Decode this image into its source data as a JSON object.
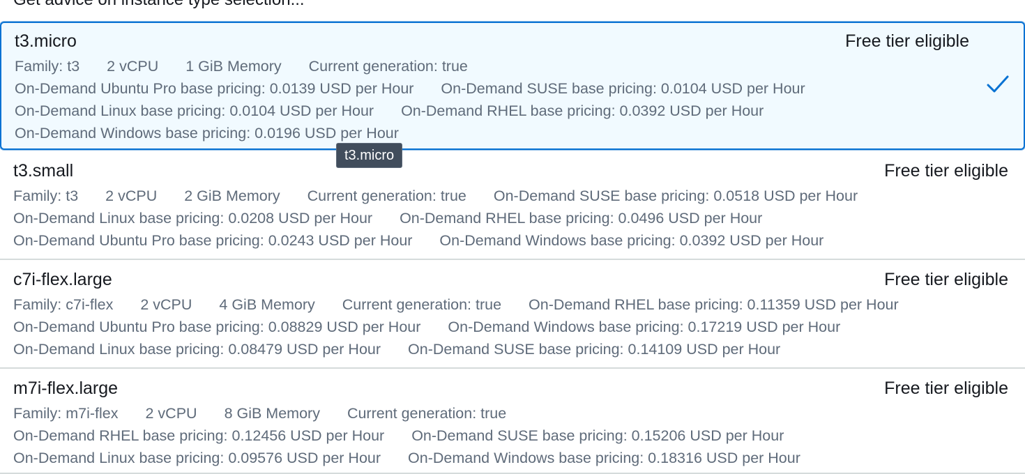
{
  "advice_link": "Get advice on instance type selection...",
  "tooltip": "t3.micro",
  "options": [
    {
      "name": "t3.micro",
      "badge": "Free tier eligible",
      "selected": true,
      "lines": [
        [
          "Family: t3",
          "2 vCPU",
          "1 GiB Memory",
          "Current generation: true"
        ],
        [
          "On-Demand Ubuntu Pro base pricing: 0.0139 USD per Hour",
          "On-Demand SUSE base pricing: 0.0104 USD per Hour"
        ],
        [
          "On-Demand Linux base pricing: 0.0104 USD per Hour",
          "On-Demand RHEL base pricing: 0.0392 USD per Hour"
        ],
        [
          "On-Demand Windows base pricing: 0.0196 USD per Hour"
        ]
      ]
    },
    {
      "name": "t3.small",
      "badge": "Free tier eligible",
      "selected": false,
      "lines": [
        [
          "Family: t3",
          "2 vCPU",
          "2 GiB Memory",
          "Current generation: true",
          "On-Demand SUSE base pricing: 0.0518 USD per Hour"
        ],
        [
          "On-Demand Linux base pricing: 0.0208 USD per Hour",
          "On-Demand RHEL base pricing: 0.0496 USD per Hour"
        ],
        [
          "On-Demand Ubuntu Pro base pricing: 0.0243 USD per Hour",
          "On-Demand Windows base pricing: 0.0392 USD per Hour"
        ]
      ]
    },
    {
      "name": "c7i-flex.large",
      "badge": "Free tier eligible",
      "selected": false,
      "lines": [
        [
          "Family: c7i-flex",
          "2 vCPU",
          "4 GiB Memory",
          "Current generation: true",
          "On-Demand RHEL base pricing: 0.11359 USD per Hour"
        ],
        [
          "On-Demand Ubuntu Pro base pricing: 0.08829 USD per Hour",
          "On-Demand Windows base pricing: 0.17219 USD per Hour"
        ],
        [
          "On-Demand Linux base pricing: 0.08479 USD per Hour",
          "On-Demand SUSE base pricing: 0.14109 USD per Hour"
        ]
      ]
    },
    {
      "name": "m7i-flex.large",
      "badge": "Free tier eligible",
      "selected": false,
      "lines": [
        [
          "Family: m7i-flex",
          "2 vCPU",
          "8 GiB Memory",
          "Current generation: true"
        ],
        [
          "On-Demand RHEL base pricing: 0.12456 USD per Hour",
          "On-Demand SUSE base pricing: 0.15206 USD per Hour"
        ],
        [
          "On-Demand Linux base pricing: 0.09576 USD per Hour",
          "On-Demand Windows base pricing: 0.18316 USD per Hour"
        ]
      ]
    }
  ],
  "colors": {
    "selected_border": "#0972d3",
    "selected_background": "#f1faff",
    "secondary_text": "#5f6b7a",
    "tooltip_background": "#414d5c"
  },
  "icons": {
    "selected_check": "check-icon"
  }
}
